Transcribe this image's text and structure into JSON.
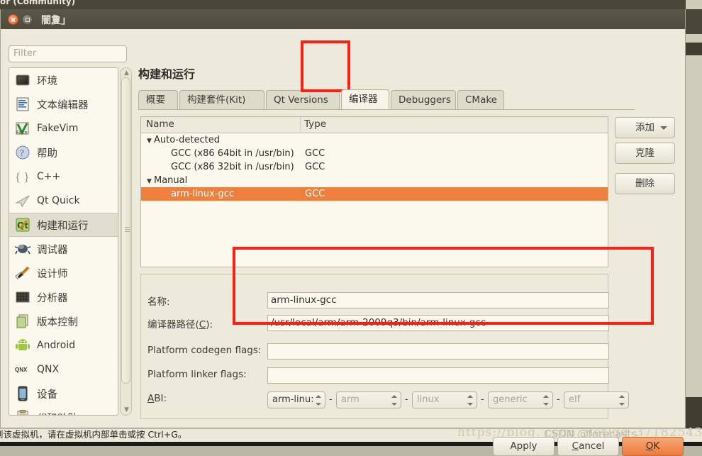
{
  "ide": {
    "window_title": "or (Community)"
  },
  "dialog": {
    "title": "闇夐」",
    "page_title": "构建和运行",
    "filter": {
      "placeholder": "Filter",
      "value": ""
    }
  },
  "sidebar": {
    "items": [
      {
        "label": "环境",
        "icon": "environment-icon"
      },
      {
        "label": "文本编辑器",
        "icon": "text-editor-icon"
      },
      {
        "label": "FakeVim",
        "icon": "fakevim-icon",
        "latin": true
      },
      {
        "label": "帮助",
        "icon": "help-icon"
      },
      {
        "label": "C++",
        "icon": "cpp-icon",
        "latin": true
      },
      {
        "label": "Qt Quick",
        "icon": "qt-quick-icon",
        "latin": true
      },
      {
        "label": "构建和运行",
        "icon": "build-run-icon",
        "selected": true
      },
      {
        "label": "调试器",
        "icon": "debugger-icon"
      },
      {
        "label": "设计师",
        "icon": "designer-icon"
      },
      {
        "label": "分析器",
        "icon": "analyzer-icon"
      },
      {
        "label": "版本控制",
        "icon": "version-control-icon"
      },
      {
        "label": "Android",
        "icon": "android-icon",
        "latin": true
      },
      {
        "label": "QNX",
        "icon": "qnx-icon",
        "latin": true
      },
      {
        "label": "设备",
        "icon": "devices-icon"
      },
      {
        "label": "代码粘贴",
        "icon": "code-paste-icon"
      }
    ]
  },
  "tabs": [
    {
      "label": "概要",
      "active": false
    },
    {
      "label": "构建套件(Kit)",
      "active": false
    },
    {
      "label": "Qt Versions",
      "active": false
    },
    {
      "label": "编译器",
      "active": true
    },
    {
      "label": "Debuggers",
      "active": false
    },
    {
      "label": "CMake",
      "active": false
    }
  ],
  "table": {
    "columns": [
      "Name",
      "Type"
    ],
    "rows": [
      {
        "name": "Auto-detected",
        "type": "",
        "group": true,
        "expander": "▼",
        "indent": 0,
        "selected": false
      },
      {
        "name": "GCC (x86 64bit in /usr/bin)",
        "type": "GCC",
        "group": false,
        "expander": "",
        "indent": 1,
        "selected": false
      },
      {
        "name": "GCC (x86 32bit in /usr/bin)",
        "type": "GCC",
        "group": false,
        "expander": "",
        "indent": 1,
        "selected": false
      },
      {
        "name": "Manual",
        "type": "",
        "group": true,
        "expander": "▼",
        "indent": 0,
        "selected": false
      },
      {
        "name": "arm-linux-gcc",
        "type": "GCC",
        "group": false,
        "expander": "",
        "indent": 1,
        "selected": true
      }
    ]
  },
  "side_buttons": [
    {
      "label": "添加",
      "menu": true
    },
    {
      "label": "克隆",
      "menu": false
    },
    {
      "label": "删除",
      "menu": false
    }
  ],
  "form": {
    "name_label": "名称:",
    "name_value": "arm-linux-gcc",
    "path_label": "编译器路径(C):",
    "path_value": "/usr/local/arm/arm-2009q3/bin/arm-linux-gcc",
    "codegen_label": "Platform codegen flags:",
    "codegen_value": "",
    "linker_label": "Platform linker flags:",
    "linker_value": "",
    "abi_label": "ABI:",
    "abi": {
      "preset": "arm-linu:",
      "arch": "arm",
      "os": "linux",
      "flavor": "generic",
      "format": "elf",
      "separator": "-"
    }
  },
  "footer": {
    "apply": "Apply",
    "cancel": "Cancel",
    "ok": "OK"
  },
  "status_bar": {
    "text": "到该虚拟机，请在虚拟机内部单击或按 Ctrl+G。"
  },
  "watermark": {
    "url": "https://blog. csdn. net/qq_37182543",
    "handle": "CSDN @forecasts"
  },
  "colors": {
    "selection": "#ef7f3c",
    "annotation": "#fd1f14",
    "dialog_bg": "#edeadb",
    "field_bg": "#fbf9ee",
    "ok_button": "#ee7b3c"
  }
}
